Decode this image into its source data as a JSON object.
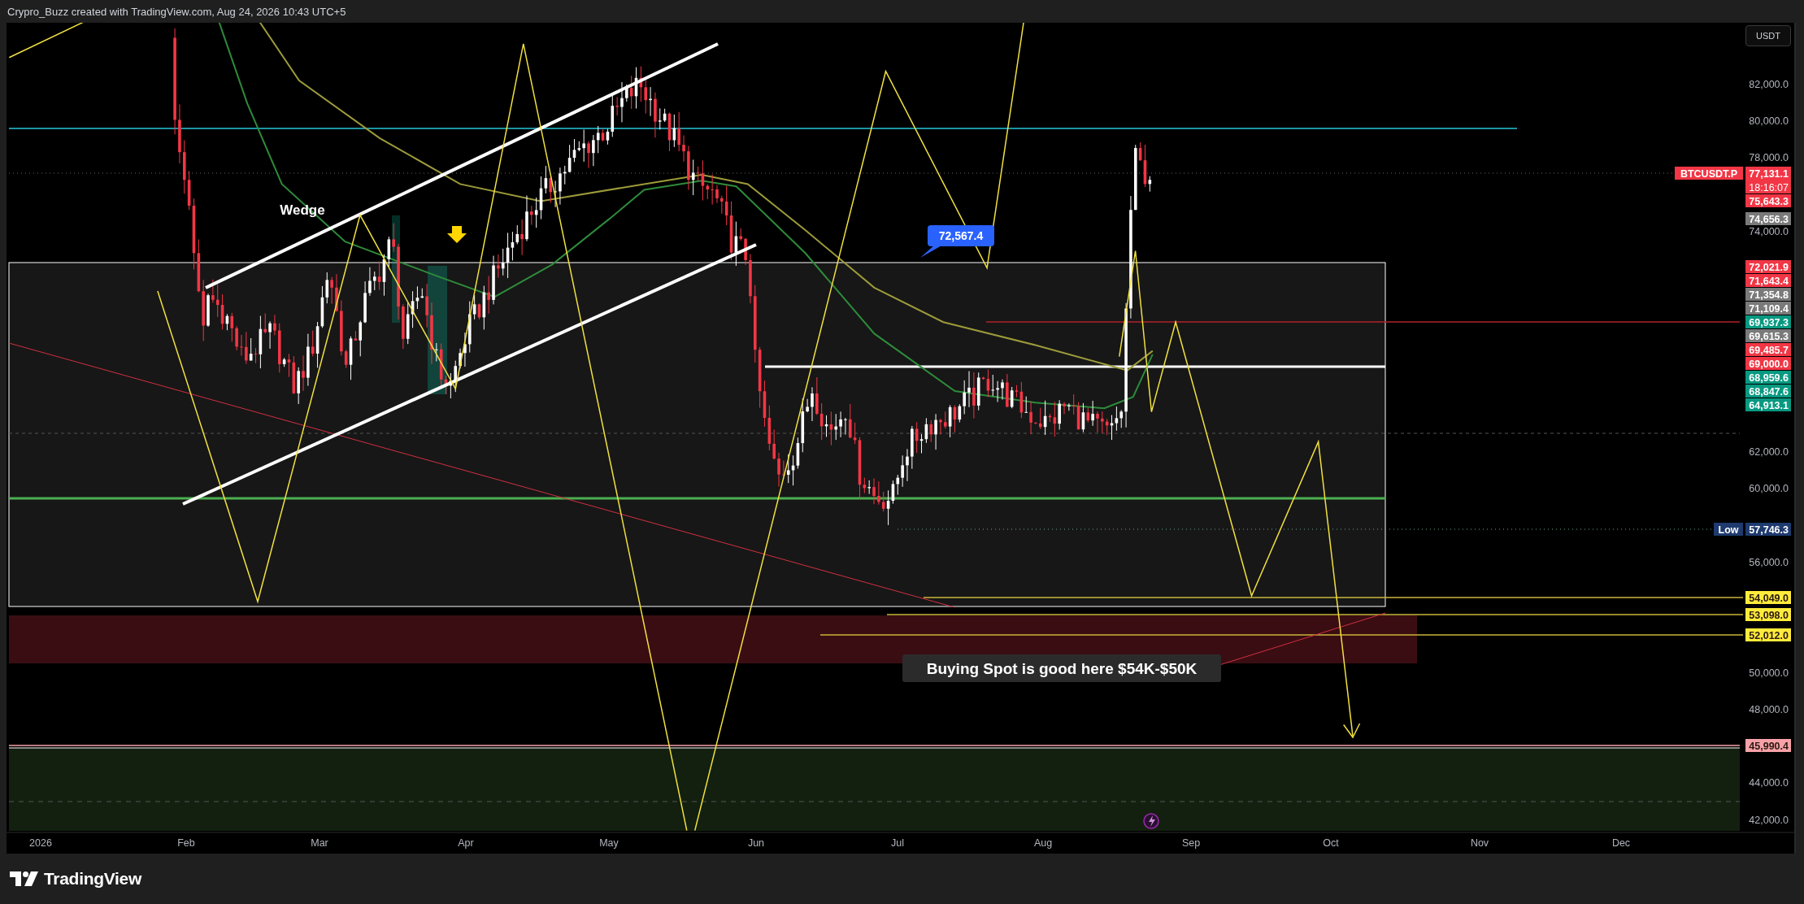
{
  "header": {
    "text": "Crypro_Buzz created with TradingView.com, Aug 24, 2026 10:43 UTC+5"
  },
  "chart": {
    "currency": "USDT",
    "price_ticks": [
      "82,000.0",
      "80,000.0",
      "78,000.0",
      "74,000.0",
      "62,000.0",
      "60,000.0",
      "56,000.0",
      "50,000.0",
      "48,000.0",
      "44,000.0",
      "42,000.0"
    ],
    "time_ticks": [
      "2026",
      "Feb",
      "Mar",
      "Apr",
      "May",
      "Jun",
      "Jul",
      "Aug",
      "Sep",
      "Oct",
      "Nov",
      "Dec"
    ],
    "price_labels": [
      {
        "text": "77,131.1",
        "color": "#f23645",
        "tag": "BTCUSDT.P",
        "countdown": "18:16:07"
      },
      {
        "text": "75,643.3",
        "color": "#f23645"
      },
      {
        "text": "74,656.3",
        "color": "#7a7a7a"
      },
      {
        "text": "72,021.9",
        "color": "#f23645"
      },
      {
        "text": "71,643.4",
        "color": "#f23645"
      },
      {
        "text": "71,354.8",
        "color": "#7a7a7a"
      },
      {
        "text": "71,109.4",
        "color": "#7a7a7a"
      },
      {
        "text": "69,937.3",
        "color": "#089981"
      },
      {
        "text": "69,615.3",
        "color": "#7a7a7a"
      },
      {
        "text": "69,485.7",
        "color": "#f23645"
      },
      {
        "text": "69,000.0",
        "color": "#f23645"
      },
      {
        "text": "68,959.6",
        "color": "#089981"
      },
      {
        "text": "68,847.6",
        "color": "#089981"
      },
      {
        "text": "64,913.1",
        "color": "#089981"
      },
      {
        "text": "57,746.3",
        "color": "#1e3a6e",
        "tag": "Low"
      },
      {
        "text": "54,049.0",
        "color": "#ffeb3b"
      },
      {
        "text": "53,098.0",
        "color": "#ffeb3b"
      },
      {
        "text": "52,012.0",
        "color": "#ffeb3b"
      },
      {
        "text": "45,990.4",
        "color": "#f7a1a8"
      }
    ],
    "annotations": {
      "wedge": "Wedge",
      "callout": "72,567.4",
      "note": "Buying Spot is good here $54K-$50K"
    }
  },
  "footer": {
    "logo": "TradingView"
  }
}
